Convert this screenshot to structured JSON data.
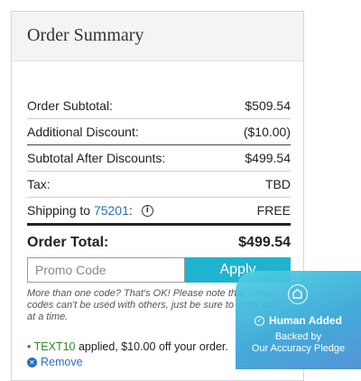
{
  "order_summary": {
    "title": "Order Summary",
    "rows": [
      {
        "label": "Order Subtotal:",
        "value": "$509.54"
      },
      {
        "label": "Additional Discount:",
        "value": "($10.00)"
      },
      {
        "label": "Subtotal After Discounts:",
        "value": "$499.54"
      },
      {
        "label": "Tax:",
        "value": "TBD"
      }
    ],
    "shipping": {
      "label_prefix": "Shipping to ",
      "zip": "75201",
      "label_suffix": ":",
      "value": "FREE",
      "icon": "info-icon"
    },
    "total": {
      "label": "Order Total:",
      "value": "$499.54"
    }
  },
  "promo": {
    "placeholder": "Promo Code",
    "value": "",
    "apply_label": "Apply",
    "note": "More than one code? That's OK! Please note that some codes can't be used with others, just be sure to enter one at a time.",
    "applied_bullet": "•",
    "applied_code": "TEXT10",
    "applied_text": " applied, $10.00 off your order.",
    "remove_label": "Remove",
    "remove_icon": "close-circle-icon"
  },
  "badge": {
    "icon": "home-shield-icon",
    "check_icon": "check-circle-icon",
    "line1": "Human Added",
    "line2a": "Backed by",
    "line2b": "Our Accuracy Pledge"
  },
  "colors": {
    "accent": "#1fb3d0",
    "link": "#2a6ebb",
    "applied_code": "#2e8b2e"
  }
}
